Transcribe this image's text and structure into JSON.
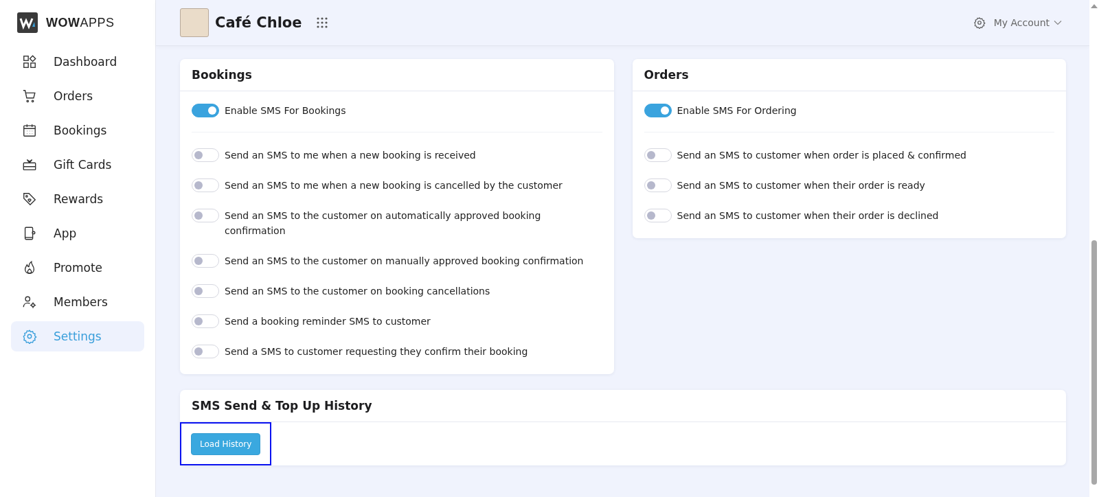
{
  "sidebar": {
    "brand": {
      "bold": "WOW",
      "light": "APPS"
    },
    "items": [
      {
        "label": "Dashboard",
        "kind": "dashboard",
        "selected": false
      },
      {
        "label": "Orders",
        "kind": "cart",
        "selected": false
      },
      {
        "label": "Bookings",
        "kind": "calendar",
        "selected": false
      },
      {
        "label": "Gift Cards",
        "kind": "gift",
        "selected": false
      },
      {
        "label": "Rewards",
        "kind": "tag",
        "selected": false
      },
      {
        "label": "App",
        "kind": "phone",
        "selected": false
      },
      {
        "label": "Promote",
        "kind": "flame",
        "selected": false
      },
      {
        "label": "Members",
        "kind": "members",
        "selected": false
      },
      {
        "label": "Settings",
        "kind": "gear",
        "selected": true
      }
    ]
  },
  "header": {
    "venue": "Café Chloe",
    "account": "My Account"
  },
  "panels": [
    {
      "title": "Bookings",
      "master": {
        "label": "Enable SMS For Bookings",
        "on": true
      },
      "options": [
        {
          "label": "Send an SMS to me when a new booking is received",
          "on": false
        },
        {
          "label": "Send an SMS to me when a new booking is cancelled by the customer",
          "on": false
        },
        {
          "label": "Send an SMS to the customer on automatically approved booking confirmation",
          "on": false
        },
        {
          "label": "Send an SMS to the customer on manually approved booking confirmation",
          "on": false
        },
        {
          "label": "Send an SMS to the customer on booking cancellations",
          "on": false
        },
        {
          "label": "Send a booking reminder SMS to customer",
          "on": false
        },
        {
          "label": "Send a SMS to customer requesting they confirm their booking",
          "on": false
        }
      ]
    },
    {
      "title": "Orders",
      "master": {
        "label": "Enable SMS For Ordering",
        "on": true
      },
      "options": [
        {
          "label": "Send an SMS to customer when order is placed & confirmed",
          "on": false
        },
        {
          "label": "Send an SMS to customer when their order is ready",
          "on": false
        },
        {
          "label": "Send an SMS to customer when their order is declined",
          "on": false
        }
      ]
    }
  ],
  "history": {
    "title": "SMS Send & Top Up History",
    "button": {
      "label": "Load History",
      "highlighted": true
    }
  }
}
